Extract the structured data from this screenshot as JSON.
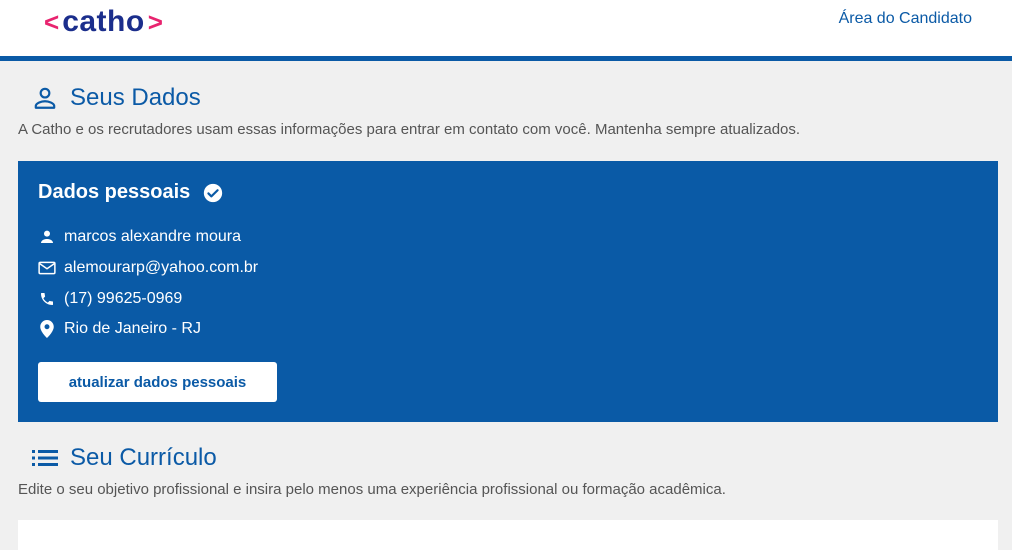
{
  "header": {
    "logo": {
      "left_bracket": "<",
      "text": "catho",
      "right_bracket": ">"
    },
    "area_link": "Área do Candidato"
  },
  "personal_section": {
    "icon": "person-outline-icon",
    "title": "Seus Dados",
    "description": "A Catho e os recrutadores usam essas informações para entrar em contato com você. Mantenha sempre atualizados."
  },
  "personal_card": {
    "title": "Dados pessoais",
    "title_icon": "check-circle-icon",
    "name": "marcos alexandre moura",
    "email": "alemourarp@yahoo.com.br",
    "phone": "(17) 99625-0969",
    "location": "Rio de Janeiro - RJ",
    "button_label": "atualizar dados pessoais"
  },
  "resume_section": {
    "icon": "list-icon",
    "title": "Seu Currículo",
    "description": "Edite o seu objetivo profissional e insira pelo menos uma experiência profissional ou formação acadêmica."
  },
  "colors": {
    "primary": "#0a5aa6",
    "logo_accent": "#e8246f",
    "logo_text": "#1b2e8c",
    "background": "#f0f0f0"
  }
}
